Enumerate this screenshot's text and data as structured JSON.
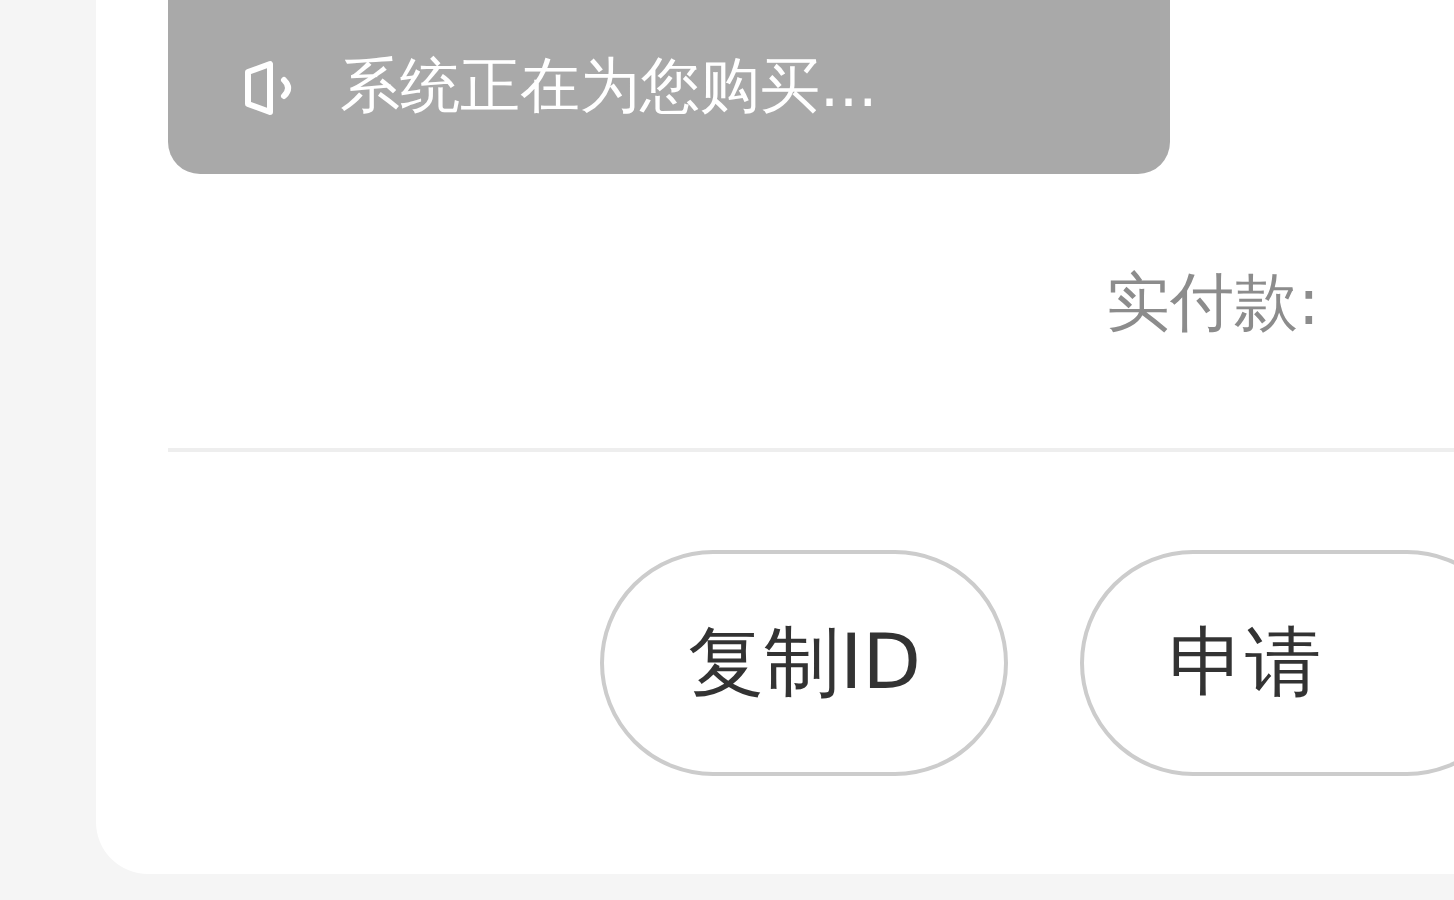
{
  "toast": {
    "text": "系统正在为您购买..."
  },
  "payment": {
    "label": "实付款:"
  },
  "buttons": [
    {
      "label": "复制ID"
    },
    {
      "label": "申请"
    }
  ]
}
